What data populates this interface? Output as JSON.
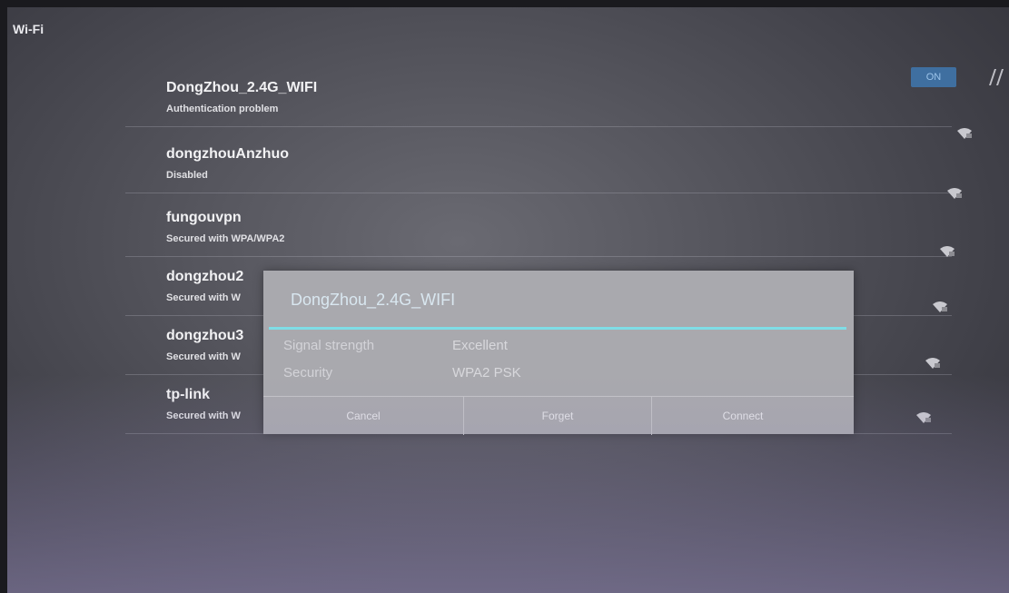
{
  "header": {
    "title": "Wi-Fi"
  },
  "toggle": {
    "label": "ON"
  },
  "networks": [
    {
      "name": "DongZhou_2.4G_WIFI",
      "status": "Authentication problem"
    },
    {
      "name": "dongzhouAnzhuo",
      "status": "Disabled"
    },
    {
      "name": "fungouvpn",
      "status": "Secured with WPA/WPA2"
    },
    {
      "name": "dongzhou2",
      "status": "Secured with W"
    },
    {
      "name": "dongzhou3",
      "status": "Secured with W"
    },
    {
      "name": "tp-link",
      "status": "Secured with W"
    }
  ],
  "dialog": {
    "title": "DongZhou_2.4G_WIFI",
    "signal_label": "Signal strength",
    "signal_value": "Excellent",
    "security_label": "Security",
    "security_value": "WPA2 PSK",
    "cancel_label": "Cancel",
    "forget_label": "Forget",
    "connect_label": "Connect"
  },
  "colors": {
    "accent_line": "#7fdde6",
    "toggle_bg": "#3f6fa0",
    "dialog_bg": "#a9a9ae"
  }
}
